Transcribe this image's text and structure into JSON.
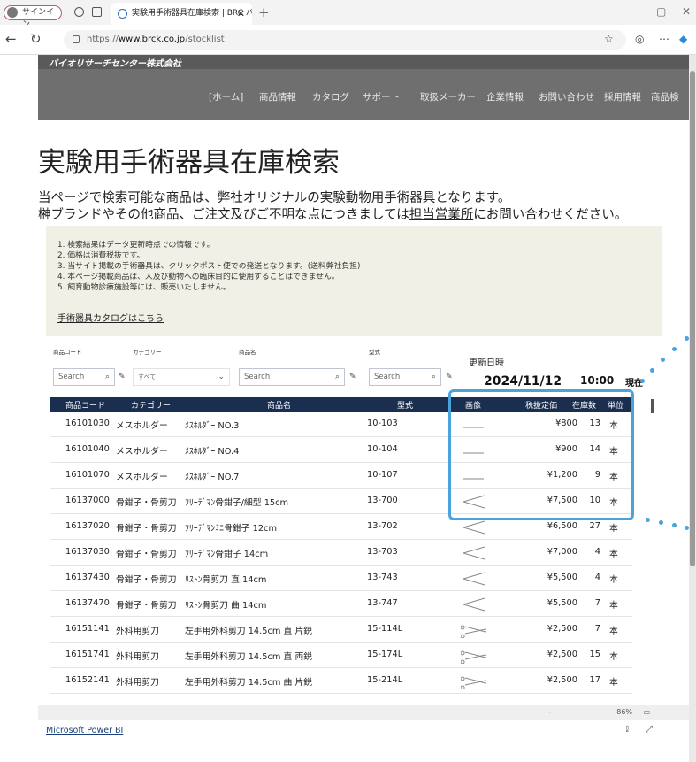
{
  "browser": {
    "profile_label": "サインイン",
    "tab_title": "実験用手術器具在庫検索 | BRC バ",
    "url_prefix": "https://",
    "url_host": "www.brck.co.jp",
    "url_path": "/stocklist"
  },
  "site": {
    "logo_text": "バイオリサーチセンター株式会社",
    "nav": [
      "[ホーム]",
      "商品情報",
      "カタログ",
      "サポート",
      "取扱メーカー",
      "企業情報",
      "お問い合わせ",
      "採用情報",
      "商品検"
    ]
  },
  "page": {
    "title": "実験用手術器具在庫検索",
    "intro_line1": "当ページで検索可能な商品は、弊社オリジナルの実験動物用手術器具となります。",
    "intro_line2_pre": "榊ブランドやその他商品、ご注文及びご不明な点につきましては",
    "intro_link": "担当営業所",
    "intro_line2_post": "にお問い合わせください。"
  },
  "notes": {
    "items": [
      "1. 検索結果はデータ更新時点での情報です。",
      "2. 価格は消費税抜です。",
      "3. 当サイト掲載の手術器具は、クリックポスト便での発送となります。(送料弊社負担)",
      "4. 本ページ掲載商品は、人及び動物への臨床目的に使用することはできません。",
      "5. 飼育動物診療施設等には、販売いたしません。"
    ],
    "catalog_link": "手術器具カタログはこちら"
  },
  "filters": {
    "code_label": "商品コード",
    "code_placeholder": "Search",
    "category_label": "カテゴリー",
    "category_value": "すべて",
    "name_label": "商品名",
    "name_placeholder": "Search",
    "model_label": "型式",
    "model_placeholder": "Search"
  },
  "update": {
    "label": "更新日時",
    "date": "2024/11/12",
    "time": "10:00",
    "now_label": "現在"
  },
  "table": {
    "headers": [
      "商品コード",
      "カテゴリー",
      "商品名",
      "型式",
      "画像",
      "税抜定価",
      "在庫数",
      "単位"
    ],
    "rows": [
      {
        "code": "16101030",
        "category": "メスホルダー",
        "name": "ﾒｽﾎﾙﾀﾞｰ NO.3",
        "model": "10-103",
        "price": "¥800",
        "stock": "13",
        "unit": "本",
        "img": "line"
      },
      {
        "code": "16101040",
        "category": "メスホルダー",
        "name": "ﾒｽﾎﾙﾀﾞｰ NO.4",
        "model": "10-104",
        "price": "¥900",
        "stock": "14",
        "unit": "本",
        "img": "line"
      },
      {
        "code": "16101070",
        "category": "メスホルダー",
        "name": "ﾒｽﾎﾙﾀﾞｰ NO.7",
        "model": "10-107",
        "price": "¥1,200",
        "stock": "9",
        "unit": "本",
        "img": "line"
      },
      {
        "code": "16137000",
        "category": "骨鉗子・骨剪刀",
        "name": "ﾌﾘｰﾃﾞﾏﾝ骨鉗子/細型 15cm",
        "model": "13-700",
        "price": "¥7,500",
        "stock": "10",
        "unit": "本",
        "img": "forceps"
      },
      {
        "code": "16137020",
        "category": "骨鉗子・骨剪刀",
        "name": "ﾌﾘｰﾃﾞﾏﾝﾐﾆ骨鉗子 12cm",
        "model": "13-702",
        "price": "¥6,500",
        "stock": "27",
        "unit": "本",
        "img": "forceps"
      },
      {
        "code": "16137030",
        "category": "骨鉗子・骨剪刀",
        "name": "ﾌﾘｰﾃﾞﾏﾝ骨鉗子 14cm",
        "model": "13-703",
        "price": "¥7,000",
        "stock": "4",
        "unit": "本",
        "img": "forceps"
      },
      {
        "code": "16137430",
        "category": "骨鉗子・骨剪刀",
        "name": "ﾘｽﾄﾝ骨剪刀 直 14cm",
        "model": "13-743",
        "price": "¥5,500",
        "stock": "4",
        "unit": "本",
        "img": "forceps"
      },
      {
        "code": "16137470",
        "category": "骨鉗子・骨剪刀",
        "name": "ﾘｽﾄﾝ骨剪刀 曲 14cm",
        "model": "13-747",
        "price": "¥5,500",
        "stock": "7",
        "unit": "本",
        "img": "forceps"
      },
      {
        "code": "16151141",
        "category": "外科用剪刀",
        "name": "左手用外科剪刀 14.5cm 直 片鋭",
        "model": "15-114L",
        "price": "¥2,500",
        "stock": "7",
        "unit": "本",
        "img": "scissors"
      },
      {
        "code": "16151741",
        "category": "外科用剪刀",
        "name": "左手用外科剪刀 14.5cm 直 両鋭",
        "model": "15-174L",
        "price": "¥2,500",
        "stock": "15",
        "unit": "本",
        "img": "scissors"
      },
      {
        "code": "16152141",
        "category": "外科用剪刀",
        "name": "左手用外科剪刀 14.5cm 曲 片鋭",
        "model": "15-214L",
        "price": "¥2,500",
        "stock": "17",
        "unit": "本",
        "img": "scissors"
      }
    ]
  },
  "footer": {
    "zoom_minus": "-",
    "zoom_plus": "+",
    "zoom_level": "86%",
    "powerbi_link": "Microsoft Power BI"
  },
  "colors": {
    "table_header": "#1a2e4f",
    "highlight": "#4aa3dd",
    "nav_bg": "#6f6f6f"
  }
}
